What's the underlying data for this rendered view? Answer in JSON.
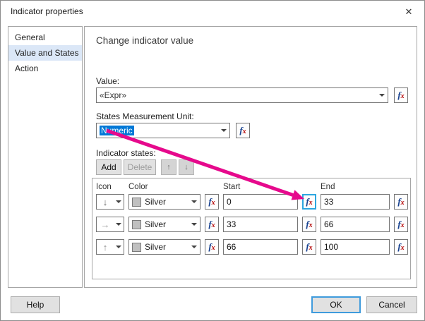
{
  "dialog": {
    "title": "Indicator properties",
    "close_glyph": "✕"
  },
  "sidebar": {
    "items": [
      {
        "label": "General"
      },
      {
        "label": "Value and States"
      },
      {
        "label": "Action"
      }
    ]
  },
  "main": {
    "heading": "Change indicator value",
    "value_label": "Value:",
    "value_text": "«Expr»",
    "unit_label": "States Measurement Unit:",
    "unit_text": "Numeric",
    "states_label": "Indicator states:",
    "toolbar": {
      "add": "Add",
      "delete": "Delete",
      "move_up_glyph": "↑",
      "move_down_glyph": "↓"
    },
    "table": {
      "headers": [
        "Icon",
        "Color",
        "Start",
        "End"
      ],
      "rows": [
        {
          "icon_glyph": "↓",
          "color": "Silver",
          "start": "0",
          "end": "33"
        },
        {
          "icon_glyph": "→",
          "color": "Silver",
          "start": "33",
          "end": "66"
        },
        {
          "icon_glyph": "↑",
          "color": "Silver",
          "start": "66",
          "end": "100"
        }
      ]
    }
  },
  "footer": {
    "help": "Help",
    "ok": "OK",
    "cancel": "Cancel"
  },
  "icons": {
    "fx_f": "f",
    "fx_x": "x"
  },
  "colors": {
    "accent": "#0078d7",
    "annotation_arrow": "#e6098c",
    "fx_highlight_border": "#2da6e0",
    "swatch_silver": "#c0c0c0"
  }
}
